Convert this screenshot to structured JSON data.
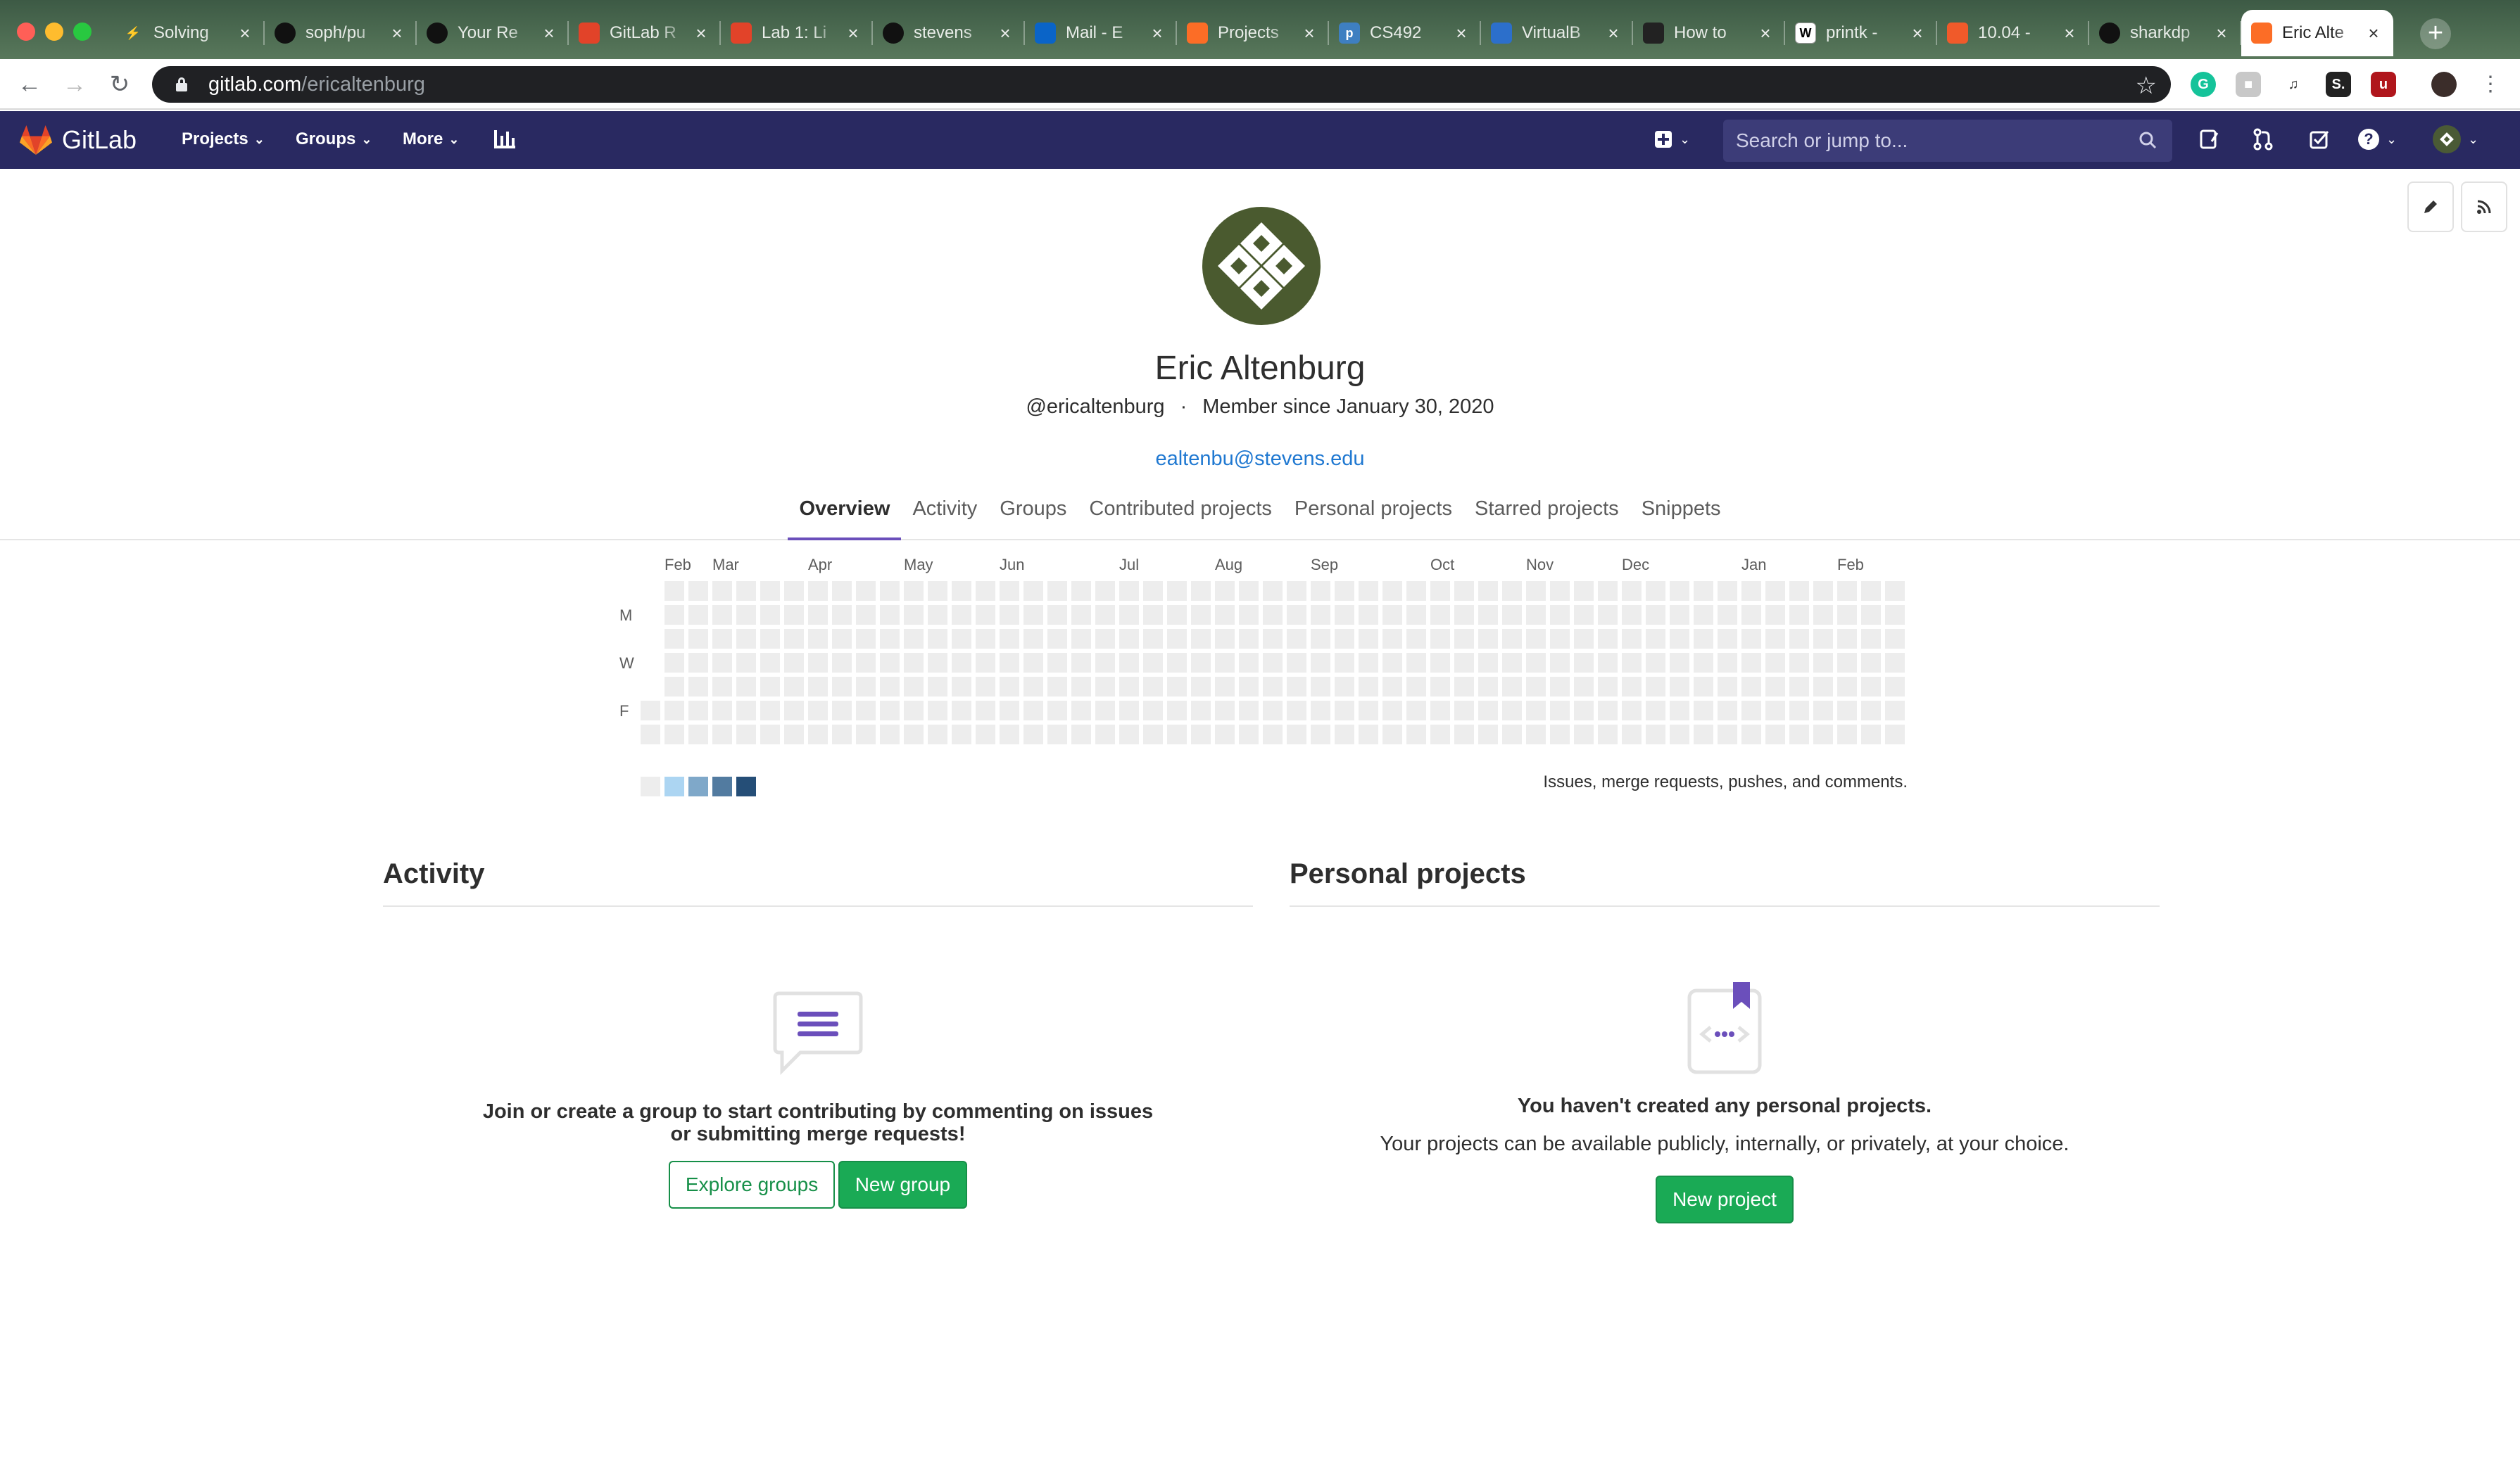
{
  "browser": {
    "tabs": [
      {
        "title": "Solving",
        "icon": "lightning-icon",
        "color": "#f5a623"
      },
      {
        "title": "soph/pu",
        "icon": "github-icon",
        "color": "#111111"
      },
      {
        "title": "Your Re",
        "icon": "github-icon",
        "color": "#111111"
      },
      {
        "title": "GitLab R",
        "icon": "gitlab-orange-icon",
        "color": "#e24329"
      },
      {
        "title": "Lab 1: Li",
        "icon": "gitlab-orange-icon",
        "color": "#e24329"
      },
      {
        "title": "stevens",
        "icon": "github-icon",
        "color": "#111111"
      },
      {
        "title": "Mail - E",
        "icon": "outlook-icon",
        "color": "#0a64c8"
      },
      {
        "title": "Projects",
        "icon": "gitlab-icon",
        "color": "#fc6d26"
      },
      {
        "title": "CS492",
        "icon": "piazza-icon",
        "color": "#3e7fc1"
      },
      {
        "title": "VirtualB",
        "icon": "virtualbox-icon",
        "color": "#2c6fcb"
      },
      {
        "title": "How to",
        "icon": "linux-icon",
        "color": "#222222"
      },
      {
        "title": "printk -",
        "icon": "wikipedia-icon",
        "color": "#ffffff"
      },
      {
        "title": "10.04 -",
        "icon": "askubuntu-icon",
        "color": "#f05a2a"
      },
      {
        "title": "sharkdp",
        "icon": "github-icon",
        "color": "#111111"
      },
      {
        "title": "Eric Alte",
        "icon": "gitlab-icon",
        "color": "#fc6d26",
        "active": true
      }
    ],
    "url_host": "gitlab.com",
    "url_path": "/ericaltenburg"
  },
  "gitlab_nav": {
    "brand": "GitLab",
    "menus": [
      "Projects",
      "Groups",
      "More"
    ],
    "search_placeholder": "Search or jump to..."
  },
  "profile": {
    "name": "Eric Altenburg",
    "username": "@ericaltenburg",
    "member_since": "Member since January 30, 2020",
    "email": "ealtenbu@stevens.edu",
    "tabs": [
      "Overview",
      "Activity",
      "Groups",
      "Contributed projects",
      "Personal projects",
      "Starred projects",
      "Snippets"
    ],
    "active_tab": "Overview"
  },
  "calendar": {
    "months": [
      "Feb",
      "Mar",
      "Apr",
      "May",
      "Jun",
      "Jul",
      "Aug",
      "Sep",
      "Oct",
      "Nov",
      "Dec",
      "Jan",
      "Feb"
    ],
    "day_labels": [
      "M",
      "W",
      "F"
    ],
    "caption": "Issues, merge requests, pushes, and comments.",
    "legend_colors": [
      "#ededed",
      "#acd5f2",
      "#7fa8c9",
      "#527ba0",
      "#254e77"
    ],
    "contributions": 0
  },
  "activity": {
    "heading": "Activity",
    "empty_text": "Join or create a group to start contributing by commenting on issues or submitting merge requests!",
    "explore_button": "Explore groups",
    "new_group_button": "New group"
  },
  "personal_projects": {
    "heading": "Personal projects",
    "empty_title": "You haven't created any personal projects.",
    "empty_subtitle": "Your projects can be available publicly, internally, or privately, at your choice.",
    "new_project_button": "New project"
  }
}
